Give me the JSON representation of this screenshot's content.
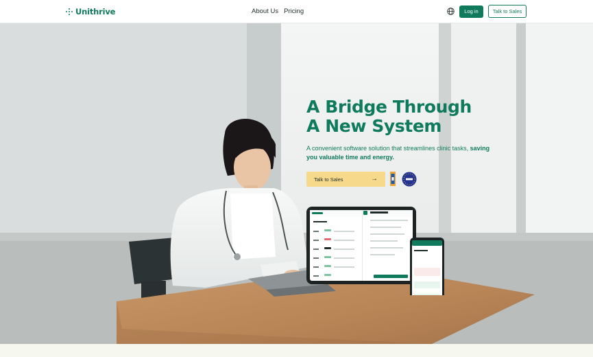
{
  "header": {
    "logo_text": "Unithrive",
    "nav": [
      "About Us",
      "Pricing"
    ],
    "login_label": "Log in",
    "sales_label": "Talk to Sales"
  },
  "hero": {
    "headline_line1": "A Bridge Through",
    "headline_line2": "A New System",
    "subtext_plain": "A convenient software solution that streamlines clinic tasks, ",
    "subtext_bold": "saving you valuable time and energy.",
    "cta_label": "Talk to Sales",
    "cta_icon": "arrow-right-icon",
    "badges": [
      "certification-badge-icon",
      "gdpr-badge-icon"
    ],
    "image": "doctor-at-laptop-photo"
  },
  "device_mockup": {
    "tablet": {
      "brand": "Unithrive",
      "list_title": "Bookings view",
      "times": [
        "9:15 am",
        "9:30 am",
        "9:45 am",
        "10 am",
        "10:15 am",
        "10:30 am"
      ],
      "detail_title": "Thursday, 04 Feb"
    },
    "phone": {
      "brand": "Unithrive"
    }
  },
  "colors": {
    "brand_green": "#0f7a5c",
    "cta_yellow": "#f7d98c",
    "strip": "#f6f8ef"
  }
}
